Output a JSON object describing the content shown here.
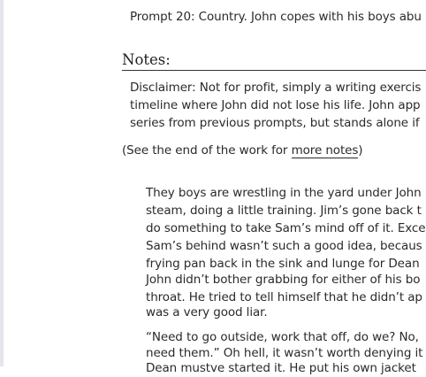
{
  "summary": {
    "line1": "Prompt 20: Country. John copes with his boys abu"
  },
  "notes": {
    "heading": "Notes:",
    "lines": [
      "Disclaimer: Not for profit, simply a writing exercis",
      "timeline where John did not lose his life. John app",
      "series from previous prompts, but stands alone if"
    ]
  },
  "see_end": {
    "prefix": "(See the end of the work for ",
    "link": "more notes",
    "suffix": ")"
  },
  "story": {
    "p1": [
      "They boys are wrestling in the yard under John",
      "steam, doing a little training. Jim’s gone back t",
      "do something to take Sam’s mind off of it. Exce",
      "Sam’s behind wasn’t such a good idea, becaus",
      "frying pan back in the sink and lunge for Dean"
    ],
    "p2": [
      "John didn’t bother grabbing for either of his bo",
      "throat. He tried to tell himself that he didn’t ap",
      "was a very good liar."
    ],
    "p3": [
      "“Need to go outside, work that off, do we? No,",
      "need them.” Oh hell, it wasn’t worth denying it",
      "Dean mustve started it. He put his own jacket"
    ]
  }
}
